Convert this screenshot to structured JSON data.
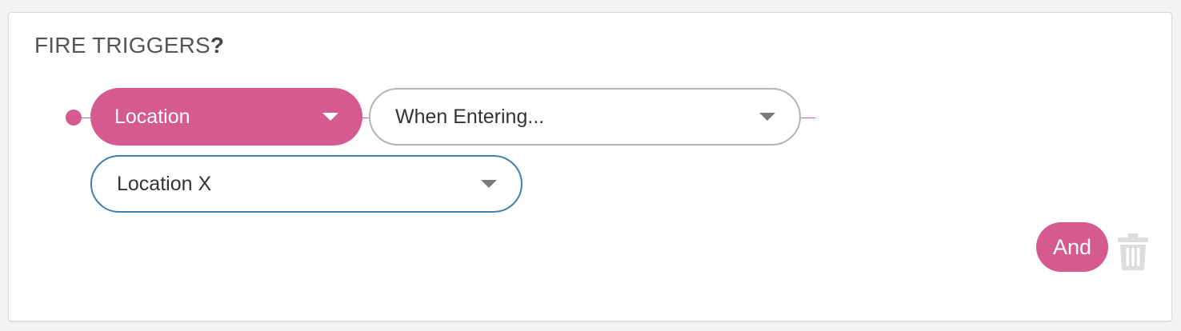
{
  "section": {
    "title": "FIRE TRIGGERS",
    "title_mark": "?"
  },
  "trigger": {
    "category": {
      "value": "Location",
      "icon": "chevron-down-icon"
    },
    "event": {
      "value": "When Entering...",
      "icon": "chevron-down-icon"
    },
    "location": {
      "value": "Location X",
      "icon": "chevron-down-icon"
    }
  },
  "actions": {
    "and_label": "And",
    "delete_icon": "trash-icon"
  },
  "colors": {
    "accent": "#d45a90",
    "focus_border": "#3f7fb0",
    "neutral_border": "#b4b4b4",
    "trash": "#dddddd"
  }
}
